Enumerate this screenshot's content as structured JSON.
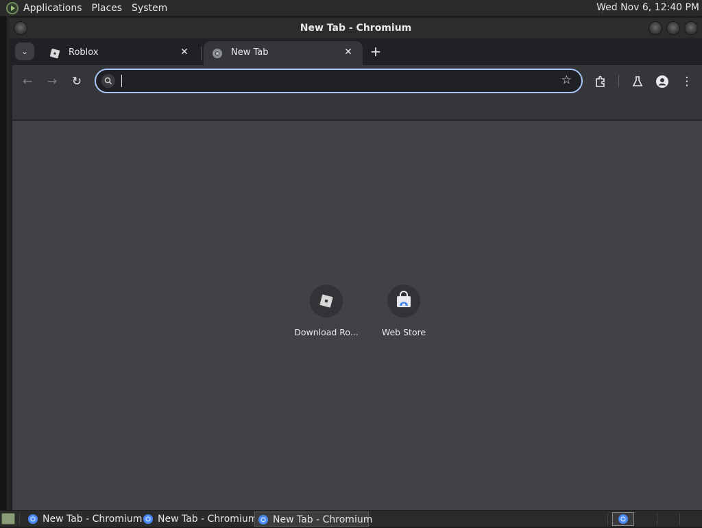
{
  "top_panel": {
    "menus": [
      "Applications",
      "Places",
      "System"
    ],
    "clock": "Wed Nov 6, 12:40 PM"
  },
  "window": {
    "title": "New Tab - Chromium"
  },
  "tabs": [
    {
      "title": "Roblox",
      "icon": "roblox-icon",
      "active": false
    },
    {
      "title": "New Tab",
      "icon": "chromium-icon",
      "active": true
    }
  ],
  "toolbar": {
    "omnibox_value": "",
    "icons": [
      "back-arrow-icon",
      "forward-arrow-icon",
      "reload-icon",
      "search-icon",
      "bookmark-star-icon",
      "extensions-icon",
      "labs-flask-icon",
      "profile-icon",
      "more-menu-icon"
    ]
  },
  "shortcuts": [
    {
      "label": "Download Ro...",
      "icon": "roblox-icon"
    },
    {
      "label": "Web Store",
      "icon": "web-store-icon"
    }
  ],
  "taskbar": {
    "tasks": [
      {
        "label": "New Tab - Chromium",
        "active": false
      },
      {
        "label": "New Tab - Chromium",
        "active": false
      },
      {
        "label": "New Tab - Chromium",
        "active": true
      }
    ]
  },
  "colors": {
    "content_bg": "#414146",
    "toolbar_bg": "#35363a",
    "omnibox_focus": "#a8c7fa"
  }
}
